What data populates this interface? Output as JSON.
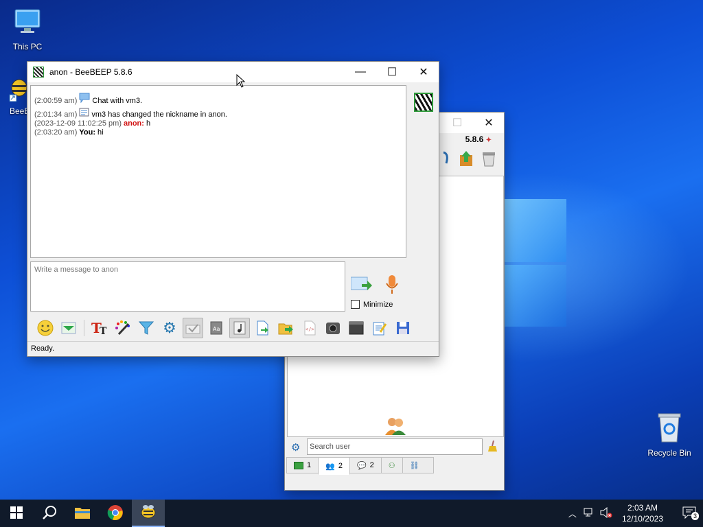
{
  "desktop": {
    "icons": [
      {
        "label": "This PC",
        "icon": "computer-icon"
      },
      {
        "label": "BeeB",
        "icon": "beebeep-icon"
      },
      {
        "label": "Recycle Bin",
        "icon": "recycle-bin-icon"
      }
    ]
  },
  "chat_window": {
    "title": "anon - BeeBEEP 5.8.6",
    "controls": {
      "minimize": "—",
      "maximize": "☐",
      "close": "✕"
    },
    "messages": [
      {
        "time": "(2:00:59 am)",
        "icon": "chat-bubble-icon",
        "text": "Chat with vm3."
      },
      {
        "time": "(2:01:34 am)",
        "icon": "system-info-icon",
        "text": "vm3 has changed the nickname in anon."
      },
      {
        "time": "(2023-12-09 11:02:25 pm)",
        "sender": "anon:",
        "text": " h"
      },
      {
        "time": "(2:03:20 am)",
        "sender": "You:",
        "text": " hi"
      }
    ],
    "input_placeholder": "Write a message to anon",
    "minimize_label": "Minimize",
    "status": "Ready.",
    "toolbar": [
      {
        "name": "emoticon",
        "icon": "smiley-icon"
      },
      {
        "name": "emoticon-panel",
        "icon": "green-arrow-down-icon"
      },
      {
        "name": "font",
        "icon": "font-icon"
      },
      {
        "name": "color",
        "icon": "color-palette-icon"
      },
      {
        "name": "filter",
        "icon": "filter-icon"
      },
      {
        "name": "settings",
        "icon": "gear-icon"
      },
      {
        "name": "spell-check",
        "icon": "spellcheck-icon"
      },
      {
        "name": "dictionary",
        "icon": "dictionary-icon"
      },
      {
        "name": "music",
        "icon": "music-note-icon"
      },
      {
        "name": "send-file",
        "icon": "send-file-icon"
      },
      {
        "name": "send-folder",
        "icon": "send-folder-icon"
      },
      {
        "name": "html",
        "icon": "html-icon"
      },
      {
        "name": "screenshot",
        "icon": "camera-icon"
      },
      {
        "name": "terminal",
        "icon": "terminal-icon"
      },
      {
        "name": "edit-notes",
        "icon": "notepad-icon"
      },
      {
        "name": "save",
        "icon": "save-icon"
      }
    ]
  },
  "main_window": {
    "version": "5.8.6",
    "search_placeholder": "Search user",
    "tabs": [
      {
        "label": "1",
        "icon": "chat-list-icon"
      },
      {
        "label": "2",
        "icon": "users-icon"
      },
      {
        "label": "2",
        "icon": "chats-icon"
      },
      {
        "label": "",
        "icon": "groups-icon"
      },
      {
        "label": "",
        "icon": "network-icon"
      }
    ]
  },
  "taskbar": {
    "apps": [
      "start-icon",
      "search-icon",
      "file-explorer-icon",
      "chrome-icon",
      "beebeep-icon"
    ],
    "clock_time": "2:03 AM",
    "clock_date": "12/10/2023",
    "notification_count": "3"
  }
}
